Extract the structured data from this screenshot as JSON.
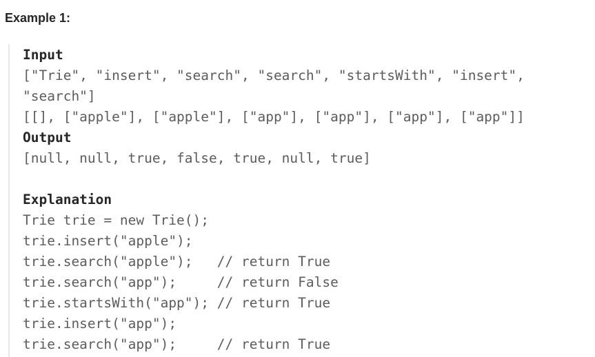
{
  "heading": "Example 1:",
  "input": {
    "label": "Input",
    "lines": [
      "[\"Trie\", \"insert\", \"search\", \"search\", \"startsWith\", \"insert\",",
      "\"search\"]",
      "[[], [\"apple\"], [\"apple\"], [\"app\"], [\"app\"], [\"app\"], [\"app\"]]"
    ]
  },
  "output": {
    "label": "Output",
    "value": "[null, null, true, false, true, null, true]"
  },
  "explanation": {
    "label": "Explanation",
    "lines": [
      "Trie trie = new Trie();",
      "trie.insert(\"apple\");",
      "trie.search(\"apple\");   // return True",
      "trie.search(\"app\");     // return False",
      "trie.startsWith(\"app\"); // return True",
      "trie.insert(\"app\");",
      "trie.search(\"app\");     // return True"
    ]
  }
}
